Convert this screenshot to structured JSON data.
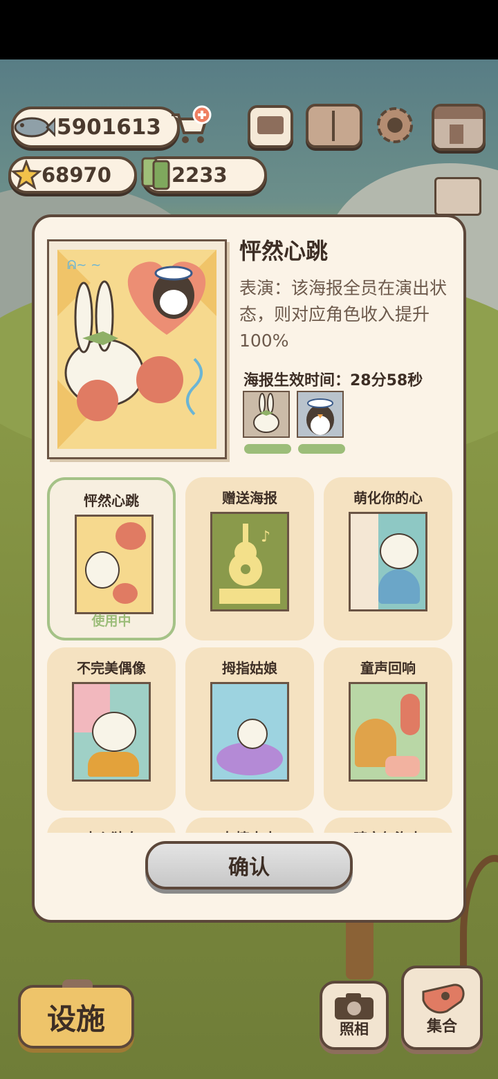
{
  "currency": {
    "fish": "5901613",
    "stars": "68970",
    "tickets": "2233"
  },
  "poster_detail": {
    "title": "怦然心跳",
    "description": "表演：该海报全员在演出状态，则对应角色收入提升100%",
    "timer_label": "海报生效时间：28分58秒"
  },
  "posters": [
    {
      "name": "怦然心跳",
      "status": "使用中",
      "bg": "#f6d98e",
      "accent": "#e07b63"
    },
    {
      "name": "赠送海报",
      "status": "",
      "bg": "#8a9a4b",
      "accent": "#f3e08a"
    },
    {
      "name": "萌化你的心",
      "status": "",
      "bg": "#8ec8c4",
      "accent": "#f2b8be"
    },
    {
      "name": "不完美偶像",
      "status": "",
      "bg": "#9fd0c6",
      "accent": "#f1c35a"
    },
    {
      "name": "拇指姑娘",
      "status": "",
      "bg": "#9dd3e0",
      "accent": "#b48ad6"
    },
    {
      "name": "童声回响",
      "status": "",
      "bg": "#b9d7a6",
      "accent": "#f2b2a0"
    },
    {
      "name": "内心独白",
      "status": "",
      "bg": "#f5e2c1",
      "accent": "#f5e2c1"
    },
    {
      "name": "友情来电",
      "status": "",
      "bg": "#f5e2c1",
      "accent": "#f5e2c1"
    },
    {
      "name": "晴空气泡水",
      "status": "",
      "bg": "#f5e2c1",
      "accent": "#f5e2c1"
    }
  ],
  "buttons": {
    "confirm": "确认",
    "facility": "设施",
    "photo": "照相",
    "gather": "集合"
  },
  "icons": [
    "fish-icon",
    "cart-plus-icon",
    "star-icon",
    "ticket-icon",
    "notice-board-icon",
    "paw-book-icon",
    "gear-icon",
    "shop-icon",
    "ranking-podium-icon",
    "camera-icon",
    "whistle-icon"
  ]
}
